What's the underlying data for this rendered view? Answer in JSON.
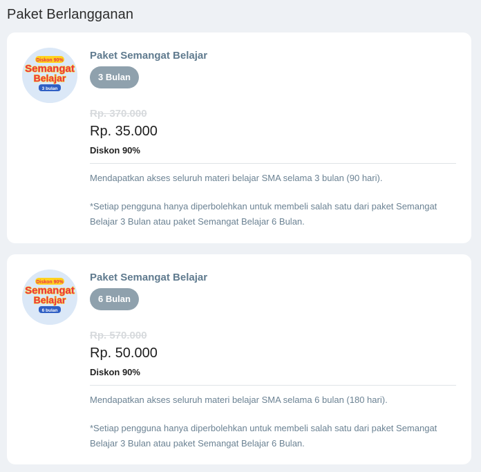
{
  "page": {
    "title": "Paket Berlangganan"
  },
  "colors": {
    "background": "#eef1f5",
    "card": "#ffffff",
    "pill": "#8fa1ad",
    "package_name": "#5f7a8e",
    "old_price": "#d7dadd",
    "description": "#6b8293"
  },
  "packages": [
    {
      "name": "Paket Semangat Belajar",
      "duration_label": "3 Bulan",
      "old_price": "Rp. 370.000",
      "price": "Rp. 35.000",
      "discount": "Diskon 90%",
      "description": "Mendapatkan akses seluruh materi belajar SMA selama 3 bulan (90 hari).",
      "note": "*Setiap pengguna hanya diperbolehkan untuk membeli salah satu dari paket Semangat Belajar 3 Bulan atau paket Semangat Belajar 6 Bulan.",
      "logo": {
        "ribbon": "Diskon 90%",
        "line1": "Semangat",
        "line2": "Belajar",
        "tag": "3 bulan"
      }
    },
    {
      "name": "Paket Semangat Belajar",
      "duration_label": "6 Bulan",
      "old_price": "Rp. 570.000",
      "price": "Rp. 50.000",
      "discount": "Diskon 90%",
      "description": "Mendapatkan akses seluruh materi belajar SMA selama 6 bulan (180 hari).",
      "note": "*Setiap pengguna hanya diperbolehkan untuk membeli salah satu dari paket Semangat Belajar 3 Bulan atau paket Semangat Belajar 6 Bulan.",
      "logo": {
        "ribbon": "Diskon 90%",
        "line1": "Semangat",
        "line2": "Belajar",
        "tag": "6 bulan"
      }
    }
  ]
}
